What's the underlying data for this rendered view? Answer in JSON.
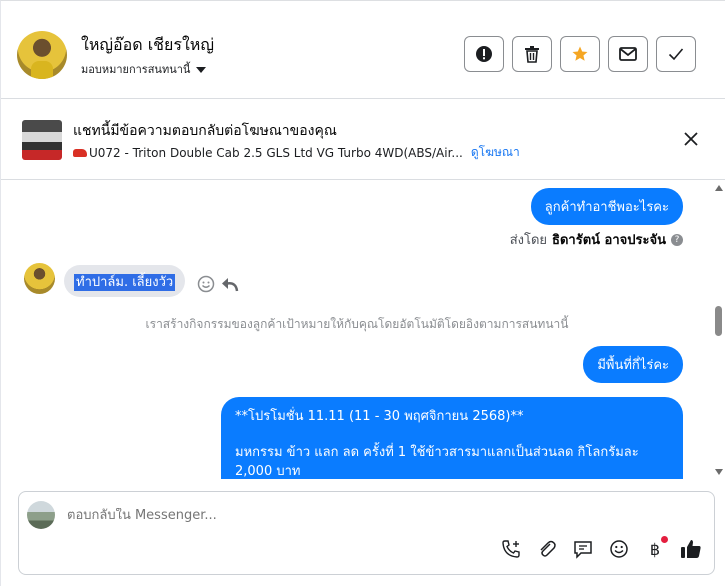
{
  "header": {
    "contact_name": "ใหญ่อ๊อด เชียรใหญ่",
    "assign_label": "มอบหมายการสนทนานี้",
    "actions": [
      {
        "name": "spam-button",
        "icon": "exclamation-circle-icon"
      },
      {
        "name": "delete-button",
        "icon": "trash-icon"
      },
      {
        "name": "star-button",
        "icon": "star-icon",
        "color": "#f5a623"
      },
      {
        "name": "mark-unread-button",
        "icon": "envelope-icon"
      },
      {
        "name": "mark-done-button",
        "icon": "check-icon"
      }
    ]
  },
  "ad_banner": {
    "title": "แชทนี้มีข้อความตอบกลับต่อโฆษณาของคุณ",
    "subtitle": "U072 - Triton Double Cab 2.5 GLS Ltd VG Turbo 4WD(ABS/Air...",
    "link": "ดูโฆษณา",
    "car_icon": "car-icon"
  },
  "messages": {
    "out_1": "ลูกค้าทำอาชีพอะไรคะ",
    "sent_by_prefix": "ส่งโดย",
    "sent_by_name": "ธิดารัตน์ อาจประจัน",
    "help": "?",
    "in_1": "ทำปาล์ม. เลี้ยงวัว",
    "system": "เราสร้างกิจกรรมของลูกค้าเป้าหมายให้กับคุณโดยอัตโนมัติโดยอิงตามการสนทนานี้",
    "out_2": "มีพื้นที่กี่ไร่คะ",
    "promo_line1": "**โปรโมชั่น 11.11  (11 - 30 พฤศจิกายน 2568)**",
    "promo_line2": "มหกรรม ข้าว แลก ลด ครั้งที่ 1 ใช้ข้าวสารมาแลกเป็นส่วนลด กิโลกรัมละ",
    "promo_line3": "2,000 บาท"
  },
  "composer": {
    "placeholder": "ตอบกลับใน Messenger...",
    "currency_symbol": "฿"
  },
  "colors": {
    "accent": "#0a7cff",
    "link": "#1877f2",
    "star": "#f5a623"
  }
}
